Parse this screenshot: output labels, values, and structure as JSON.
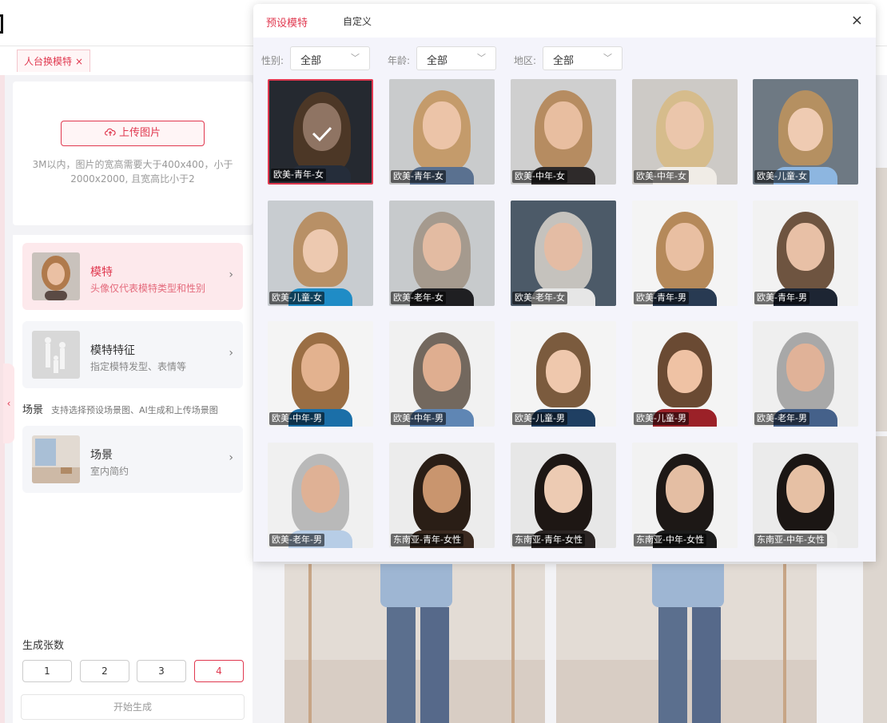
{
  "tabs": [
    {
      "label": "人台换模特",
      "close": "×"
    }
  ],
  "upload": {
    "button_label": "上传图片",
    "tip_line1": "3M以内，图片的宽高需要大于400x400，小于",
    "tip_line2": "2000x2000, 且宽高比小于2"
  },
  "settings": {
    "model_card": {
      "title": "模特",
      "sub": "头像仅代表模特类型和性别"
    },
    "feature_card": {
      "title": "模特特征",
      "sub": "指定模特发型、表情等"
    },
    "scene_section": {
      "label": "场景",
      "hint": "支持选择预设场景图、AI生成和上传场景图"
    },
    "scene_card": {
      "title": "场景",
      "sub": "室内简约"
    },
    "count_label": "生成张数",
    "counts": [
      "1",
      "2",
      "3",
      "4"
    ],
    "selected_count": "4",
    "generate_label": "开始生成",
    "chevron": "›",
    "collapse_arrow": "‹"
  },
  "popup": {
    "tab_preset": "预设模特",
    "tab_custom": "自定义",
    "close": "×",
    "filters": [
      {
        "label": "性别:",
        "value": "全部"
      },
      {
        "label": "年龄:",
        "value": "全部"
      },
      {
        "label": "地区:",
        "value": "全部"
      }
    ],
    "dropdown_glyph": "﹀",
    "models": [
      {
        "label": "欧美-青年-女",
        "selected": true
      },
      {
        "label": "欧美-青年-女"
      },
      {
        "label": "欧美-中年-女"
      },
      {
        "label": "欧美-中年-女"
      },
      {
        "label": "欧美-儿童-女"
      },
      {
        "label": "欧美-儿童-女"
      },
      {
        "label": "欧美-老年-女"
      },
      {
        "label": "欧美-老年-女"
      },
      {
        "label": "欧美-青年-男"
      },
      {
        "label": "欧美-青年-男"
      },
      {
        "label": "欧美-中年-男"
      },
      {
        "label": "欧美-中年-男"
      },
      {
        "label": "欧美-儿童-男"
      },
      {
        "label": "欧美-儿童-男"
      },
      {
        "label": "欧美-老年-男"
      },
      {
        "label": "欧美-老年-男"
      },
      {
        "label": "东南亚-青年-女性"
      },
      {
        "label": "东南亚-青年-女性"
      },
      {
        "label": "东南亚-中年-女性"
      },
      {
        "label": "东南亚-中年-女性"
      }
    ]
  },
  "colors": {
    "accent": "#e0384f",
    "accent_bg": "#fde9ec"
  }
}
